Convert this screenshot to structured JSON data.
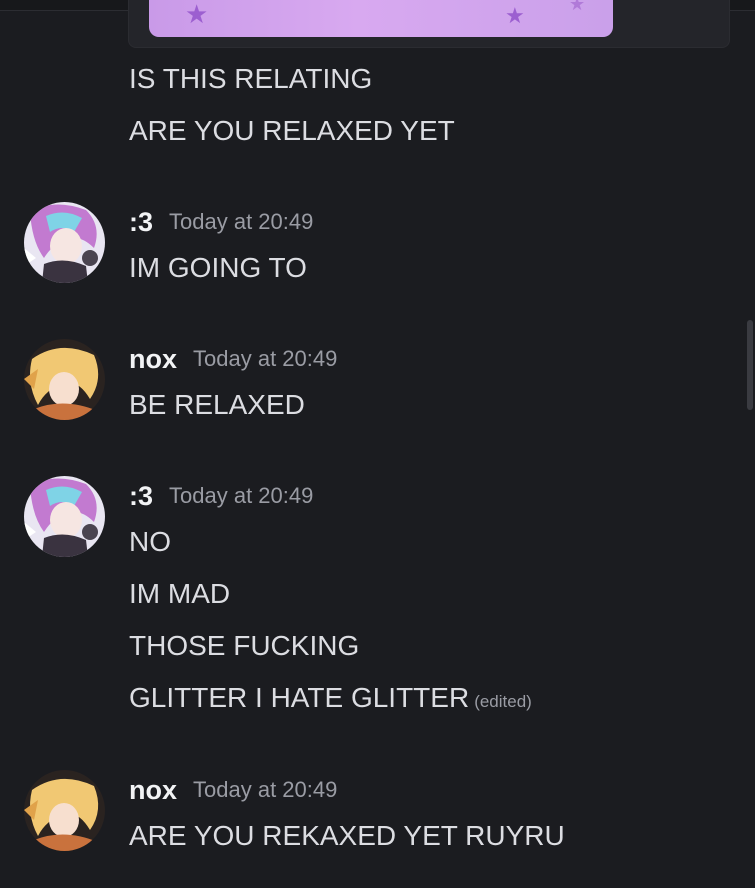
{
  "messages_pre": [
    "IS THIS RELATING",
    "ARE YOU RELAXED YET"
  ],
  "groups": [
    {
      "username": ":3",
      "timestamp": "Today at 20:49",
      "avatar": "pink-haired-character-avatar",
      "lines": [
        "IM GOING TO"
      ]
    },
    {
      "username": "nox",
      "timestamp": "Today at 20:49",
      "avatar": "blonde-character-avatar",
      "lines": [
        "BE RELAXED"
      ]
    },
    {
      "username": ":3",
      "timestamp": "Today at 20:49",
      "avatar": "pink-haired-character-avatar",
      "lines": [
        "NO",
        "IM MAD",
        "THOSE FUCKING",
        "GLITTER I HATE GLITTER"
      ],
      "edited": "(edited)"
    },
    {
      "username": "nox",
      "timestamp": "Today at 20:49",
      "avatar": "blonde-character-avatar",
      "lines": [
        "ARE YOU REKAXED YET RUYRU"
      ]
    }
  ],
  "colors": {
    "background": "#1b1c20",
    "text": "#dcdde2",
    "timestamp": "#9a9ca4",
    "embed_image": "#d8a9f0"
  }
}
